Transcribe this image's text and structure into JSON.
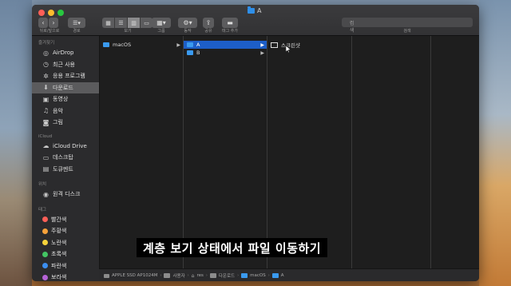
{
  "window": {
    "title": "A"
  },
  "toolbar": {
    "back_forward_label": "뒤로/앞으로",
    "path_label": "경로",
    "view_label": "보기",
    "group_label": "그룹",
    "action_label": "동작",
    "share_label": "공유",
    "tag_label": "태그 추가",
    "search_label": "검색",
    "search_placeholder": "검색"
  },
  "sidebar": {
    "favorites_header": "즐겨찾기",
    "favorites": [
      {
        "label": "AirDrop",
        "icon": "airdrop-icon"
      },
      {
        "label": "최근 사용",
        "icon": "clock-icon"
      },
      {
        "label": "응용 프로그램",
        "icon": "apps-icon"
      },
      {
        "label": "다운로드",
        "icon": "download-icon",
        "active": true
      },
      {
        "label": "동영상",
        "icon": "film-icon"
      },
      {
        "label": "음악",
        "icon": "music-icon"
      },
      {
        "label": "그림",
        "icon": "camera-icon"
      }
    ],
    "icloud_header": "iCloud",
    "icloud": [
      {
        "label": "iCloud Drive",
        "icon": "cloud-icon"
      },
      {
        "label": "데스크탑",
        "icon": "desktop-icon"
      },
      {
        "label": "도큐멘트",
        "icon": "document-icon"
      }
    ],
    "locations_header": "위치",
    "locations": [
      {
        "label": "원격 디스크",
        "icon": "disc-icon"
      }
    ],
    "tags_header": "태그",
    "tags": [
      {
        "label": "빨간색",
        "color": "#fe5f57"
      },
      {
        "label": "주황색",
        "color": "#f7a23a"
      },
      {
        "label": "노란색",
        "color": "#f5d33b"
      },
      {
        "label": "초록색",
        "color": "#43c463"
      },
      {
        "label": "파란색",
        "color": "#3b8ef0"
      },
      {
        "label": "보라색",
        "color": "#b563d6"
      }
    ]
  },
  "columns": {
    "col1": [
      {
        "label": "macOS"
      }
    ],
    "col2": [
      {
        "label": "A"
      },
      {
        "label": "B"
      }
    ],
    "col3": [
      {
        "label": "스크린샷"
      }
    ]
  },
  "pathbar": [
    "APPLE SSD AP1024M",
    "사용자",
    "res",
    "다운로드",
    "macOS",
    "A"
  ],
  "subtitle": "계층 보기 상태에서 파일 이동하기"
}
